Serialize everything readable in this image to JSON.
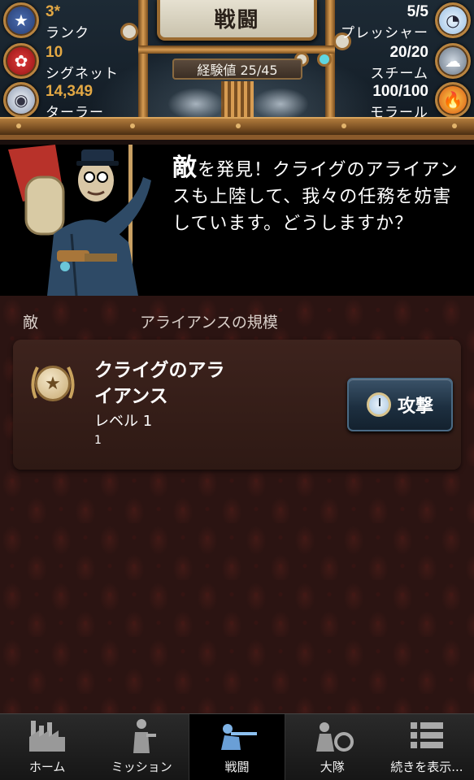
{
  "header": {
    "title": "戦闘",
    "experience": "経験値 25/45",
    "left_stats": [
      {
        "value": "3*",
        "label": "ランク",
        "icon": "rank-medal-icon"
      },
      {
        "value": "10",
        "label": "シグネット",
        "icon": "signet-seal-icon"
      },
      {
        "value": "14,349",
        "label": "ターラー",
        "icon": "thaler-coin-icon"
      }
    ],
    "right_stats": [
      {
        "value": "5/5",
        "label": "プレッシャー",
        "icon": "pressure-gauge-icon"
      },
      {
        "value": "20/20",
        "label": "スチーム",
        "icon": "steam-icon"
      },
      {
        "value": "100/100",
        "label": "モラール",
        "icon": "morale-flame-icon"
      }
    ]
  },
  "story": {
    "first_char": "敵",
    "text": "を発見！クライグのアライアンスも上陸して、我々の任務を妨害しています。どうしますか？"
  },
  "table": {
    "col_enemy": "敵",
    "col_size": "アライアンスの規模"
  },
  "enemy": {
    "name": "クライグのアライアンス",
    "level": "レベル 1",
    "size": "1",
    "attack_label": "攻撃"
  },
  "nav": [
    {
      "label": "ホーム",
      "icon": "factory-icon"
    },
    {
      "label": "ミッション",
      "icon": "soldier-icon"
    },
    {
      "label": "戦闘",
      "icon": "sniper-icon",
      "active": true
    },
    {
      "label": "大隊",
      "icon": "battalion-icon"
    },
    {
      "label": "続きを表示...",
      "icon": "list-icon"
    }
  ]
}
